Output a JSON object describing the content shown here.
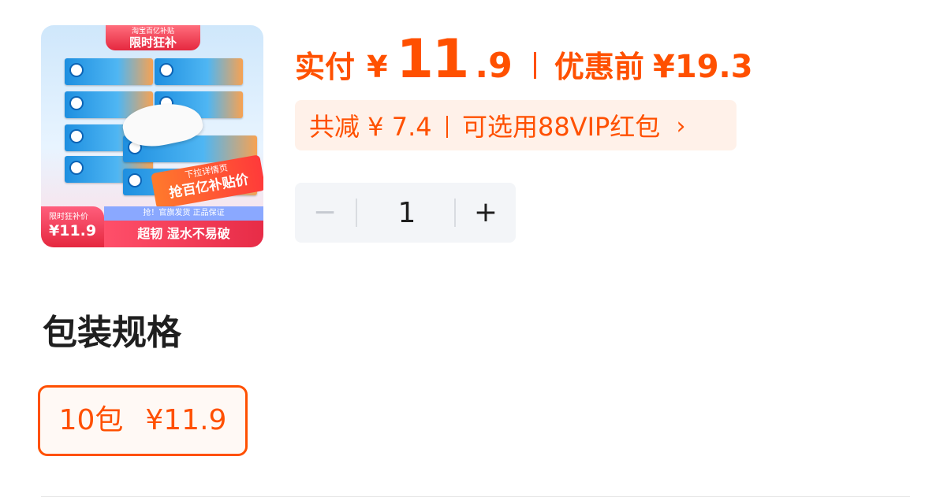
{
  "product": {
    "image": {
      "top_badge_small": "淘宝百亿补贴",
      "top_badge_large": "限时狂补",
      "promo_line1": "下拉详情页",
      "promo_line2": "抢百亿补贴价",
      "price_label": "限时狂补价",
      "price": "¥11.9",
      "strip_text": "抢！官旗发货 正品保证",
      "slogan": "超韧 湿水不易破"
    }
  },
  "price": {
    "pay_label": "实付",
    "currency": "¥",
    "integer": "11",
    "decimal": ".9",
    "before_label": "优惠前",
    "before_price": "¥19.3"
  },
  "discount": {
    "total": "共减 ¥ 7.4",
    "redpacket": "可选用88VIP红包",
    "chevron": "›"
  },
  "quantity": {
    "minus": "−",
    "value": "1",
    "plus": "+"
  },
  "spec": {
    "title": "包装规格",
    "options": [
      {
        "name": "10包",
        "price": "¥11.9",
        "selected": true
      }
    ]
  },
  "colors": {
    "accent": "#ff5000",
    "discount_bg": "#fff1e9",
    "stepper_bg": "#f3f5f8"
  }
}
